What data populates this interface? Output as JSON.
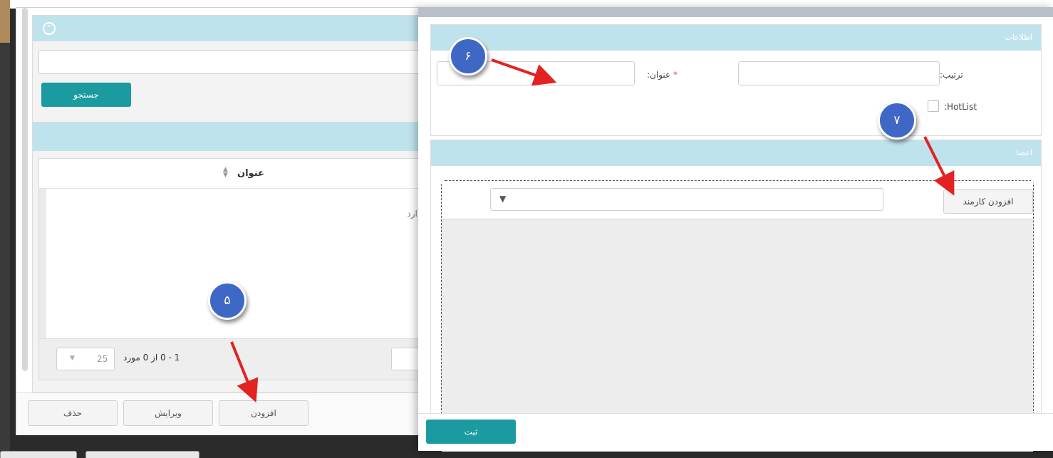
{
  "left_window": {
    "search_button": "جستجو",
    "grid": {
      "column_title": "عنوان",
      "empty_text": "دارد.",
      "page_size": "25",
      "pager_info": "1 - 0 از 0 مورد"
    },
    "footer": {
      "delete_label": "حذف",
      "edit_label": "ویرایش",
      "add_label": "افزودن"
    }
  },
  "dialog": {
    "info_panel": {
      "title": "اطلاعات",
      "title_label": "عنوان:",
      "required_mark": "*",
      "order_label": "ترتیب:",
      "hotlist_label": ":HotList",
      "title_value": "",
      "order_value": ""
    },
    "members_panel": {
      "title": "اعضا",
      "add_employee_label": "افزودن کارمند",
      "filter_value": ""
    },
    "submit_label": "ثبت"
  },
  "annotations": {
    "badge_5": "۵",
    "badge_6": "۶",
    "badge_7": "۷"
  },
  "colors": {
    "accent_teal": "#1b9aa0",
    "panel_header": "#bfe3ec",
    "badge_blue": "#3f67c6",
    "arrow_red": "#e32222"
  }
}
